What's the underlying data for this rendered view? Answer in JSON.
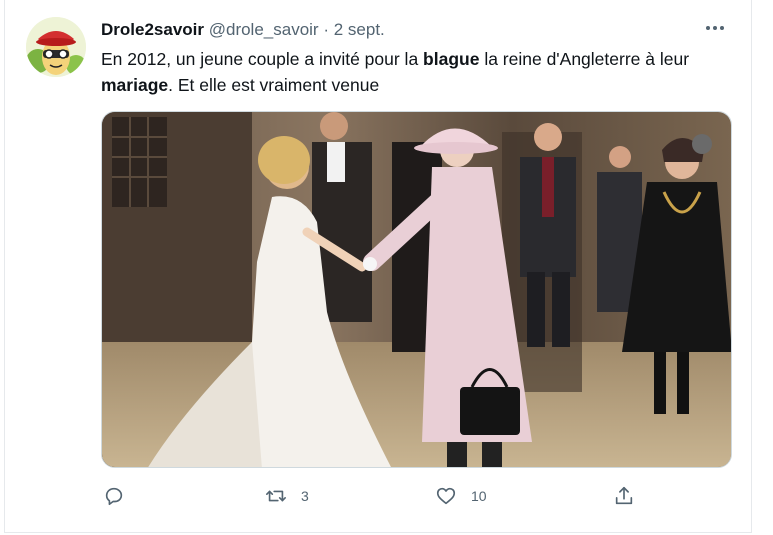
{
  "tweet": {
    "author_name": "Drole2savoir",
    "handle": "@drole_savoir",
    "separator": "·",
    "date": "2 sept.",
    "text_part1": "En 2012, un jeune couple a invité pour la ",
    "text_bold1": "blague",
    "text_part2": " la reine d'Angleterre à leur ",
    "text_bold2": "mariage",
    "text_part3": ". Et elle est vraiment venue",
    "more_icon": "more-horizontal-icon",
    "media_icon": "photo-wedding-queen"
  },
  "actions": {
    "reply_count": "",
    "retweet_count": "3",
    "like_count": "10",
    "share_count": ""
  },
  "colors": {
    "text": "#0f1419",
    "secondary": "#536471",
    "border": "#e6e9ec"
  }
}
